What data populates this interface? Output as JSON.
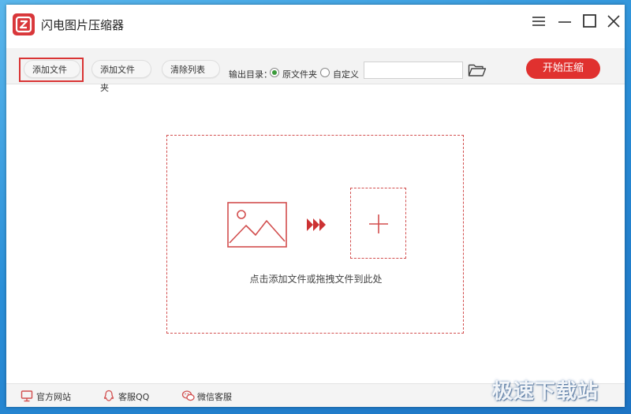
{
  "app": {
    "title": "闪电图片压缩器"
  },
  "window_controls": {
    "icons": [
      "menu-icon",
      "minimize-icon",
      "maximize-icon",
      "close-icon"
    ]
  },
  "toolbar": {
    "add_file_label": "添加文件",
    "add_folder_label": "添加文件夹",
    "clear_list_label": "清除列表",
    "output_dir_label": "输出目录：",
    "output_options": [
      {
        "label": "原文件夹",
        "selected": true
      },
      {
        "label": "自定义",
        "selected": false
      }
    ],
    "path_value": "",
    "start_label": "开始压缩"
  },
  "dropzone": {
    "hint": "点击添加文件或拖拽文件到此处"
  },
  "footer": {
    "links": [
      {
        "label": "官方网站",
        "icon": "monitor-icon"
      },
      {
        "label": "客服QQ",
        "icon": "qq-icon"
      },
      {
        "label": "微信客服",
        "icon": "wechat-icon"
      }
    ]
  },
  "watermark": {
    "text": "极速下载站"
  },
  "colors": {
    "accent": "#e0312f",
    "dashed_border": "#d24e4e",
    "radio_checked": "#3a9a3a"
  }
}
